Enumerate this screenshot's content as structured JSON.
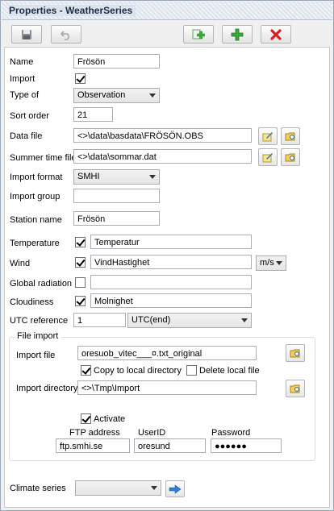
{
  "window": {
    "title": "Properties - WeatherSeries"
  },
  "colors": {
    "add": "#3aa83a",
    "delete": "#d42020",
    "go": "#2f7fd9"
  },
  "toolbar": {
    "save_icon": "floppy-disk-icon",
    "undo_icon": "undo-icon",
    "copy_add_icon": "copy-add-icon",
    "add_icon": "plus-icon",
    "delete_icon": "red-x-icon"
  },
  "form": {
    "name": {
      "label": "Name",
      "value": "Frösön"
    },
    "import": {
      "label": "Import",
      "checked": true
    },
    "type_of": {
      "label": "Type of",
      "value": "Observation"
    },
    "sort_order": {
      "label": "Sort order",
      "value": "21"
    },
    "data_file": {
      "label": "Data file",
      "value": "<>\\data\\basdata\\FRÖSÖN.OBS"
    },
    "summer_time_file": {
      "label": "Summer time file",
      "value": "<>\\data\\sommar.dat"
    },
    "import_format": {
      "label": "Import format",
      "value": "SMHI"
    },
    "import_group": {
      "label": "Import group",
      "value": ""
    },
    "station_name": {
      "label": "Station name",
      "value": "Frösön"
    },
    "temperature": {
      "label": "Temperature",
      "checked": true,
      "value": "Temperatur"
    },
    "wind": {
      "label": "Wind",
      "checked": true,
      "value": "VindHastighet",
      "unit": "m/s"
    },
    "global_radiation": {
      "label": "Global radiation",
      "checked": false,
      "value": ""
    },
    "cloudiness": {
      "label": "Cloudiness",
      "checked": true,
      "value": "Molnighet"
    },
    "utc_reference": {
      "label": "UTC reference",
      "value": "1",
      "mode": "UTC(end)"
    }
  },
  "file_import": {
    "group_label": "File import",
    "import_file": {
      "label": "Import file",
      "value": "oresuob_vitec___¤.txt_original"
    },
    "copy_local": {
      "label": "Copy to local directory",
      "checked": true
    },
    "delete_local": {
      "label": "Delete local file",
      "checked": false
    },
    "import_directory": {
      "label": "Import directory",
      "value": "<>\\Tmp\\Import"
    },
    "activate": {
      "label": "Activate",
      "checked": true
    },
    "ftp_address": {
      "label": "FTP address",
      "value": "ftp.smhi.se"
    },
    "user_id": {
      "label": "UserID",
      "value": "oresund"
    },
    "password": {
      "label": "Password",
      "value": "●●●●●●"
    }
  },
  "climate_series": {
    "label": "Climate series",
    "value": ""
  }
}
